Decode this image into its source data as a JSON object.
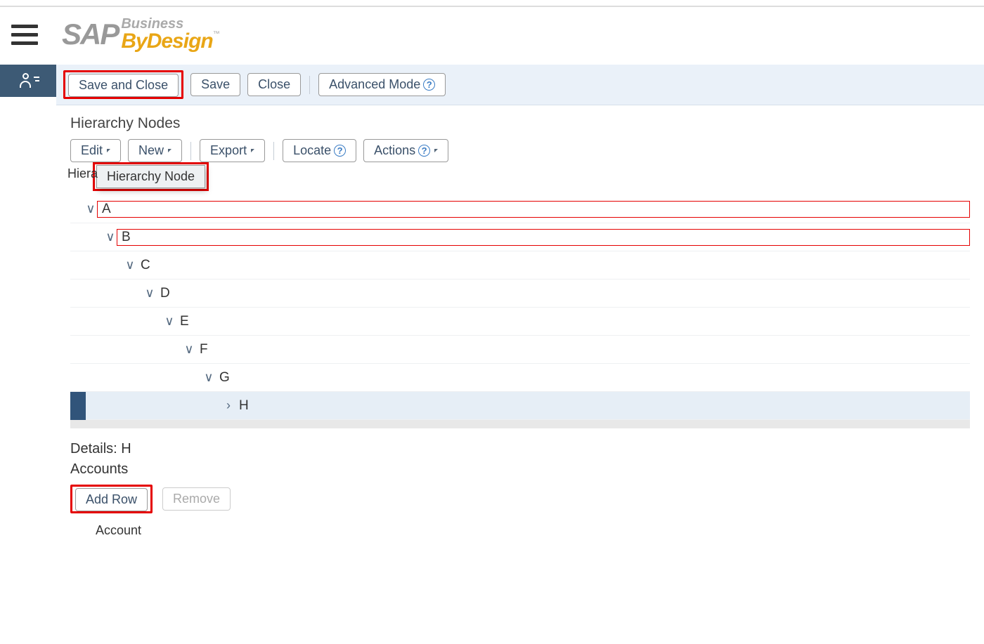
{
  "logo": {
    "sap": "SAP",
    "business": "Business",
    "bydesign": "ByDesign",
    "tm": "™"
  },
  "toolbar": {
    "save_and_close": "Save and Close",
    "save": "Save",
    "close": "Close",
    "advanced_mode": "Advanced Mode"
  },
  "hierarchy": {
    "title": "Hierarchy Nodes",
    "buttons": {
      "edit": "Edit",
      "new": "New",
      "export": "Export",
      "locate": "Locate",
      "actions": "Actions"
    },
    "tooltip_partial": "Hiera",
    "tooltip": "Hierarchy Node",
    "nodes": [
      {
        "label": "A",
        "level": 1,
        "expanded": true,
        "highlighted": true
      },
      {
        "label": "B",
        "level": 2,
        "expanded": true,
        "highlighted": true
      },
      {
        "label": "C",
        "level": 3,
        "expanded": true
      },
      {
        "label": "D",
        "level": 4,
        "expanded": true
      },
      {
        "label": "E",
        "level": 5,
        "expanded": true
      },
      {
        "label": "F",
        "level": 6,
        "expanded": true
      },
      {
        "label": "G",
        "level": 7,
        "expanded": true
      },
      {
        "label": "H",
        "level": 8,
        "expanded": false,
        "selected": true
      }
    ]
  },
  "details": {
    "title": "Details: H",
    "accounts_title": "Accounts",
    "add_row": "Add Row",
    "remove": "Remove",
    "col_account": "Account"
  },
  "help_glyph": "?"
}
